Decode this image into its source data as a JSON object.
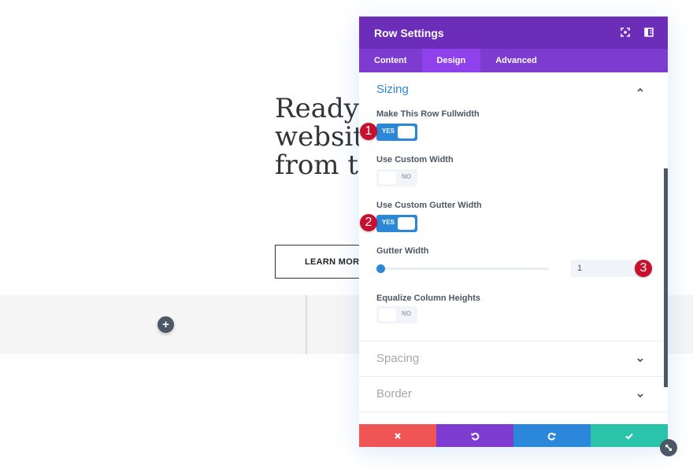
{
  "page": {
    "hero_heading": "Ready t\nwebsite\nfrom th",
    "learn_more_label": "LEARN MORE",
    "add_module_symbol": "+"
  },
  "modal": {
    "title": "Row Settings",
    "header_icons": [
      "expand-icon",
      "split-view-icon"
    ],
    "tabs": [
      {
        "label": "Content",
        "active": false
      },
      {
        "label": "Design",
        "active": true
      },
      {
        "label": "Advanced",
        "active": false
      }
    ],
    "sections": {
      "sizing": {
        "title": "Sizing",
        "expanded": true,
        "fields": {
          "fullwidth": {
            "label": "Make This Row Fullwidth",
            "value": "YES",
            "on": true
          },
          "custom_width": {
            "label": "Use Custom Width",
            "value": "NO",
            "on": false
          },
          "custom_gutter": {
            "label": "Use Custom Gutter Width",
            "value": "YES",
            "on": true
          },
          "gutter_width": {
            "label": "Gutter Width",
            "value": "1",
            "slider_fraction": 0
          },
          "equalize": {
            "label": "Equalize Column Heights",
            "value": "NO",
            "on": false
          }
        }
      },
      "spacing": {
        "title": "Spacing",
        "expanded": false
      },
      "border": {
        "title": "Border",
        "expanded": false
      }
    },
    "footer": {
      "buttons": [
        {
          "name": "cancel",
          "color": "#ef5555"
        },
        {
          "name": "undo",
          "color": "#7e3bd0"
        },
        {
          "name": "redo",
          "color": "#2b87da"
        },
        {
          "name": "save",
          "color": "#29c4a9"
        }
      ]
    }
  },
  "annotations": [
    "1",
    "2",
    "3"
  ],
  "colors": {
    "header": "#6c2eb9",
    "tabs": "#7d3bcf",
    "active_tab": "#8f42ec",
    "accent": "#2b87da",
    "badge": "#c8102e"
  }
}
